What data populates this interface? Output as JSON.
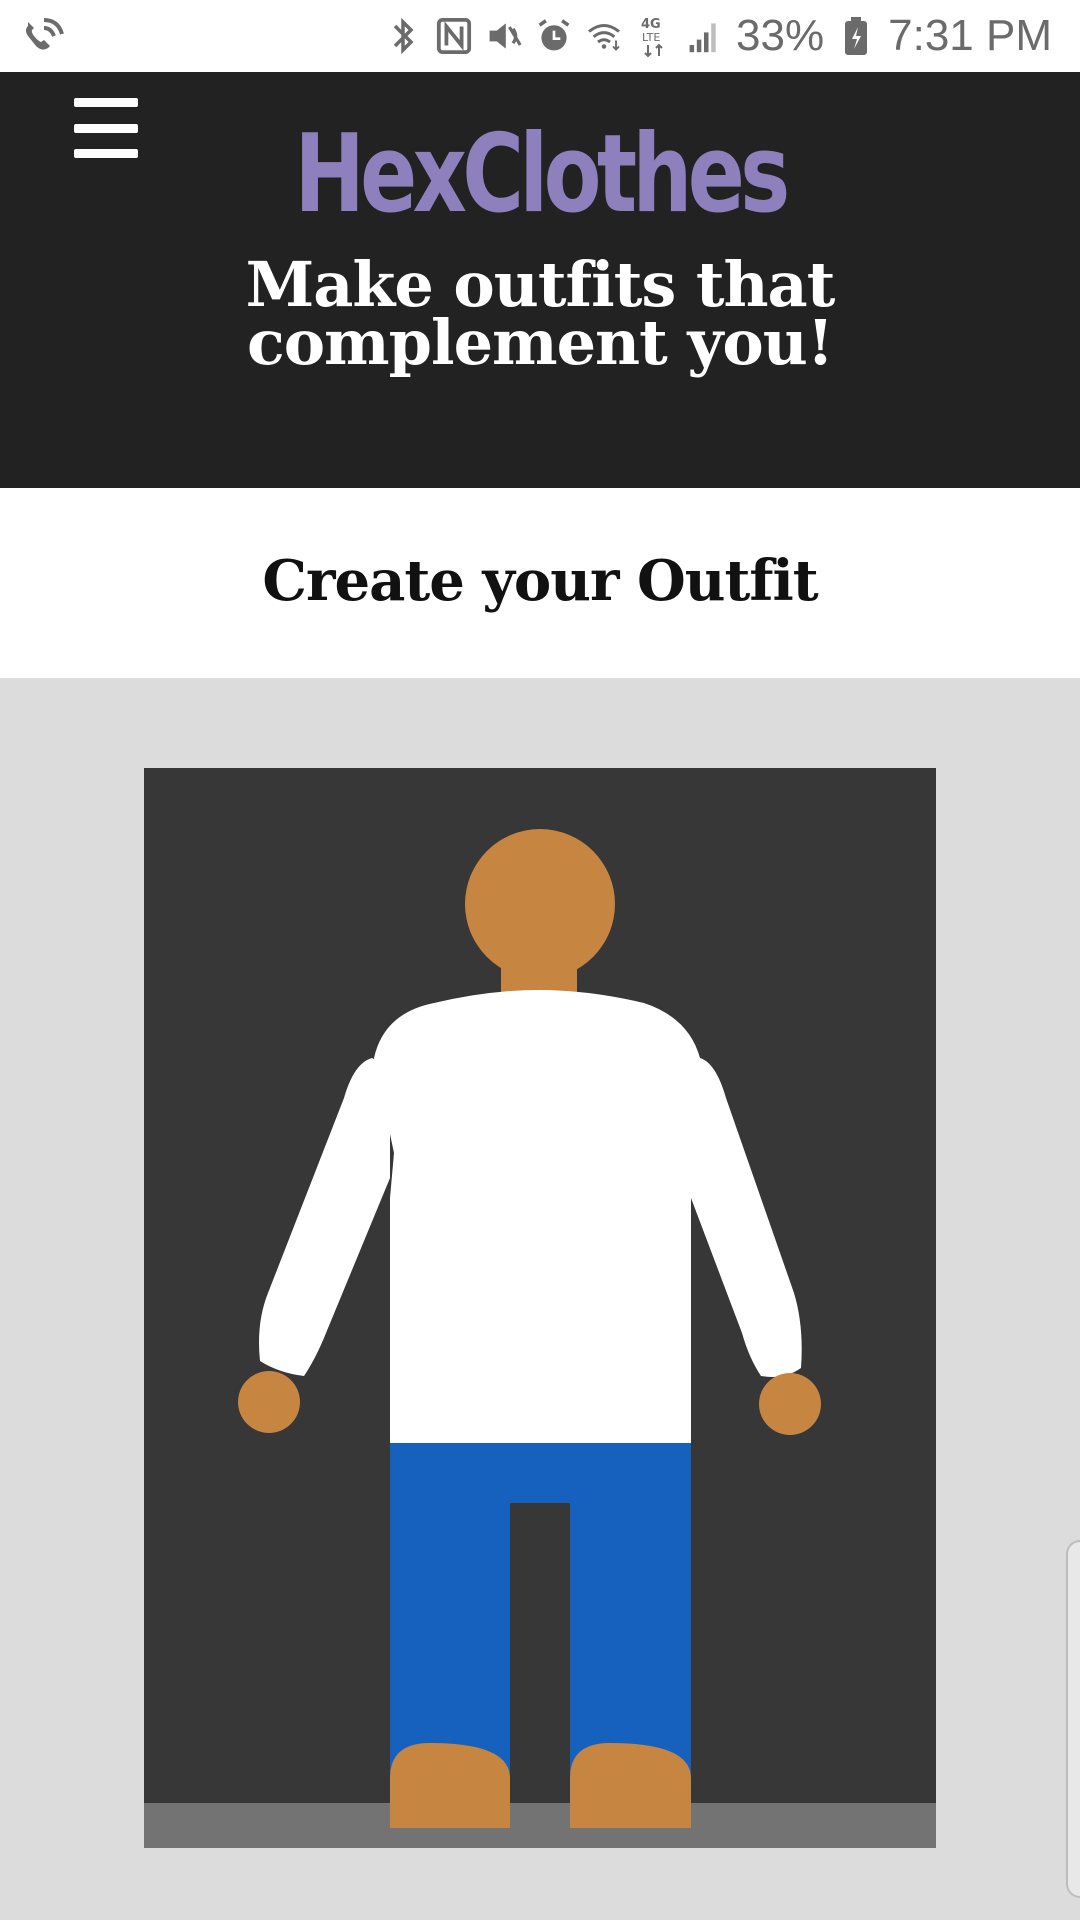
{
  "status_bar": {
    "battery": "33%",
    "time": "7:31 PM",
    "icons": [
      "wifi-calling-icon",
      "bluetooth-icon",
      "nfc-icon",
      "mute-icon",
      "alarm-icon",
      "wifi-icon",
      "lte-icon",
      "signal-icon",
      "battery-icon"
    ]
  },
  "header": {
    "brand": "HexClothes",
    "tagline": "Make outfits that complement you!",
    "menu_icon": "hamburger-menu-icon"
  },
  "section": {
    "title": "Create your Outfit"
  },
  "outfit": {
    "skin_color": "#c68642",
    "shirt_color": "#ffffff",
    "pants_color": "#1660be",
    "background_color": "#373737",
    "floor_color": "#737373"
  },
  "colors": {
    "brand": "#8e7fbd",
    "header_bg": "#222222",
    "page_bg": "#dcdcdc"
  }
}
